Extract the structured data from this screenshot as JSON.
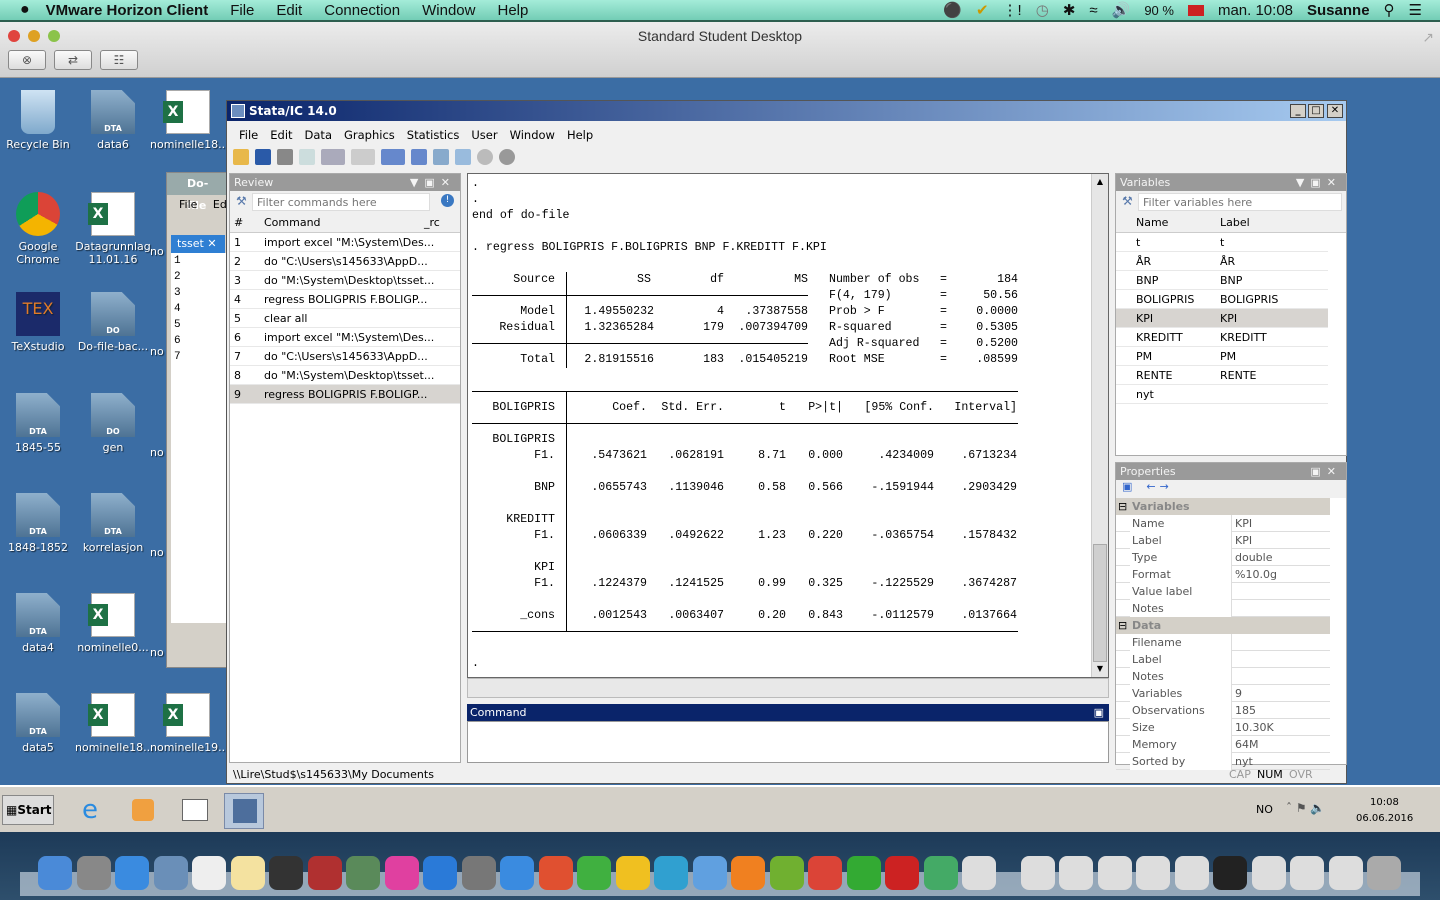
{
  "mac_menubar": {
    "app": "VMware Horizon Client",
    "menus": [
      "File",
      "Edit",
      "Connection",
      "Window",
      "Help"
    ],
    "battery": "90 %",
    "clock": "man. 10:08",
    "user": "Susanne"
  },
  "vmware": {
    "title": "Standard Student Desktop"
  },
  "desktop_icons": [
    {
      "label": "Recycle Bin",
      "type": "bin"
    },
    {
      "label": "data6",
      "type": "DTA"
    },
    {
      "label": "nominelle18...",
      "type": "xls"
    },
    {
      "label": "Google Chrome",
      "type": "chrome"
    },
    {
      "label": "Datagrunnlag 11.01.16",
      "type": "xlsdoc"
    },
    {
      "label": "TeXstudio",
      "type": "tex"
    },
    {
      "label": "Do-file-bac...",
      "type": "DO"
    },
    {
      "label": "1845-55",
      "type": "DTA"
    },
    {
      "label": "gen",
      "type": "DO"
    },
    {
      "label": "1848-1852",
      "type": "DTA"
    },
    {
      "label": "korrelasjon",
      "type": "DTA"
    },
    {
      "label": "data4",
      "type": "DTA"
    },
    {
      "label": "nominelle0...",
      "type": "xls"
    },
    {
      "label": "data5",
      "type": "DTA"
    },
    {
      "label": "nominelle18...",
      "type": "xls"
    },
    {
      "label": "nominelle19...",
      "type": "xls"
    }
  ],
  "dofile": {
    "title": "Do-file",
    "menus": [
      "File",
      "Edi"
    ],
    "tab": "tsset",
    "lines": [
      "1",
      "2",
      "3",
      "4",
      "5",
      "6",
      "7"
    ]
  },
  "stata": {
    "title": "Stata/IC 14.0",
    "menus": [
      "File",
      "Edit",
      "Data",
      "Graphics",
      "Statistics",
      "User",
      "Window",
      "Help"
    ],
    "review": {
      "title": "Review",
      "filter_placeholder": "Filter commands here",
      "cols": [
        "#",
        "Command",
        "_rc"
      ],
      "items": [
        {
          "n": "1",
          "cmd": "import excel \"M:\\System\\Des..."
        },
        {
          "n": "2",
          "cmd": "do \"C:\\Users\\s145633\\AppD..."
        },
        {
          "n": "3",
          "cmd": "do \"M:\\System\\Desktop\\tsset..."
        },
        {
          "n": "4",
          "cmd": "regress BOLIGPRIS F.BOLIGP..."
        },
        {
          "n": "5",
          "cmd": "clear all"
        },
        {
          "n": "6",
          "cmd": "import excel \"M:\\System\\Des..."
        },
        {
          "n": "7",
          "cmd": "do \"C:\\Users\\s145633\\AppD..."
        },
        {
          "n": "8",
          "cmd": "do \"M:\\System\\Desktop\\tsset..."
        },
        {
          "n": "9",
          "cmd": "regress BOLIGPRIS F.BOLIGP..."
        }
      ],
      "selected": 8
    },
    "results": {
      "pre_lines": [
        ".",
        ".",
        "end of do-file"
      ],
      "command": ". regress BOLIGPRIS F.BOLIGPRIS BNP F.KREDITT F.KPI",
      "anova_header": [
        "Source",
        "SS",
        "df",
        "MS"
      ],
      "anova_rows": [
        [
          "Model",
          "1.49550232",
          "4",
          ".37387558"
        ],
        [
          "Residual",
          "1.32365284",
          "179",
          ".007394709"
        ],
        [
          "Total",
          "2.81915516",
          "183",
          ".015405219"
        ]
      ],
      "stats": [
        [
          "Number of obs",
          "=",
          "184"
        ],
        [
          "F(4, 179)",
          "=",
          "50.56"
        ],
        [
          "Prob > F",
          "=",
          "0.0000"
        ],
        [
          "R-squared",
          "=",
          "0.5305"
        ],
        [
          "Adj R-squared",
          "=",
          "0.5200"
        ],
        [
          "Root MSE",
          "=",
          ".08599"
        ]
      ],
      "coef_header": [
        "BOLIGPRIS",
        "Coef.",
        "Std. Err.",
        "t",
        "P>|t|",
        "[95% Conf.",
        "Interval]"
      ],
      "coef_rows": [
        [
          "BOLIGPRIS",
          "",
          "",
          "",
          "",
          "",
          ""
        ],
        [
          "F1.",
          ".5473621",
          ".0628191",
          "8.71",
          "0.000",
          ".4234009",
          ".6713234"
        ],
        [
          "",
          "",
          "",
          "",
          "",
          "",
          ""
        ],
        [
          "BNP",
          ".0655743",
          ".1139046",
          "0.58",
          "0.566",
          "-.1591944",
          ".2903429"
        ],
        [
          "",
          "",
          "",
          "",
          "",
          "",
          ""
        ],
        [
          "KREDITT",
          "",
          "",
          "",
          "",
          "",
          ""
        ],
        [
          "F1.",
          ".0606339",
          ".0492622",
          "1.23",
          "0.220",
          "-.0365754",
          ".1578432"
        ],
        [
          "",
          "",
          "",
          "",
          "",
          "",
          ""
        ],
        [
          "KPI",
          "",
          "",
          "",
          "",
          "",
          ""
        ],
        [
          "F1.",
          ".1224379",
          ".1241525",
          "0.99",
          "0.325",
          "-.1225529",
          ".3674287"
        ],
        [
          "",
          "",
          "",
          "",
          "",
          "",
          ""
        ],
        [
          "_cons",
          ".0012543",
          ".0063407",
          "0.20",
          "0.843",
          "-.0112579",
          ".0137664"
        ]
      ],
      "post_lines": [
        "."
      ]
    },
    "command_window": {
      "title": "Command",
      "value": ""
    },
    "variables": {
      "title": "Variables",
      "filter_placeholder": "Filter variables here",
      "cols": [
        "Name",
        "Label"
      ],
      "items": [
        {
          "name": "t",
          "label": "t"
        },
        {
          "name": "ÅR",
          "label": "ÅR"
        },
        {
          "name": "BNP",
          "label": "BNP"
        },
        {
          "name": "BOLIGPRIS",
          "label": "BOLIGPRIS"
        },
        {
          "name": "KPI",
          "label": "KPI"
        },
        {
          "name": "KREDITT",
          "label": "KREDITT"
        },
        {
          "name": "PM",
          "label": "PM"
        },
        {
          "name": "RENTE",
          "label": "RENTE"
        },
        {
          "name": "nyt",
          "label": ""
        }
      ],
      "selected": 4
    },
    "properties": {
      "title": "Properties",
      "variables_section": "Variables",
      "variables": [
        [
          "Name",
          "KPI"
        ],
        [
          "Label",
          "KPI"
        ],
        [
          "Type",
          "double"
        ],
        [
          "Format",
          "%10.0g"
        ],
        [
          "Value label",
          ""
        ],
        [
          "Notes",
          ""
        ]
      ],
      "data_section": "Data",
      "data": [
        [
          "Filename",
          ""
        ],
        [
          "Label",
          ""
        ],
        [
          "Notes",
          ""
        ],
        [
          "Variables",
          "9"
        ],
        [
          "Observations",
          "185"
        ],
        [
          "Size",
          "10.30K"
        ],
        [
          "Memory",
          "64M"
        ],
        [
          "Sorted by",
          "nyt"
        ]
      ]
    },
    "status": {
      "path": "\\\\Lire\\Stud$\\s145633\\My Documents",
      "cap": "CAP",
      "num": "NUM",
      "ovr": "OVR"
    }
  },
  "taskbar": {
    "start": "Start",
    "lang": "NO",
    "time": "10:08",
    "date": "06.06.2016"
  },
  "colors": {
    "desktop": "#3b6da4",
    "stata_title": "#0a246a",
    "selection": "#d7d4d0"
  }
}
